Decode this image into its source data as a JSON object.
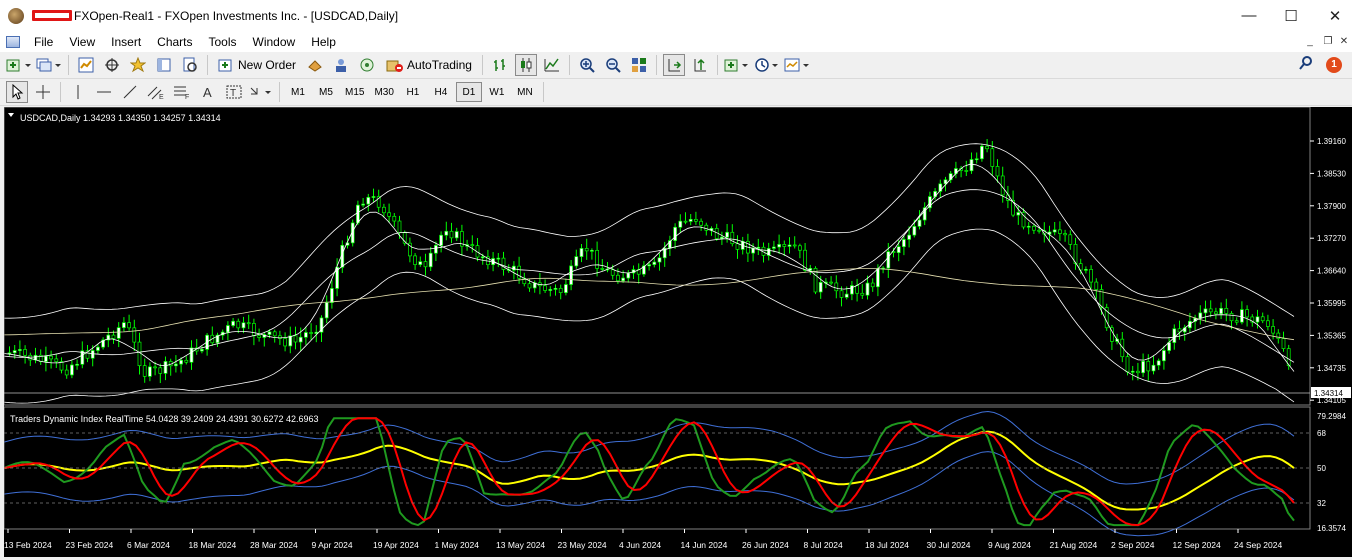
{
  "window": {
    "title": "FXOpen-Real1 - FXOpen Investments Inc. - [USDCAD,Daily]",
    "minimize": "—",
    "maximize": "☐",
    "close": "✕"
  },
  "menu": [
    "File",
    "View",
    "Insert",
    "Charts",
    "Tools",
    "Window",
    "Help"
  ],
  "toolbar": {
    "new_order": "New Order",
    "auto_trading": "AutoTrading"
  },
  "periods": [
    "M1",
    "M5",
    "M15",
    "M30",
    "H1",
    "H4",
    "D1",
    "W1",
    "MN"
  ],
  "active_period": "D1",
  "notifications": "1",
  "chart": {
    "header": "USDCAD,Daily  1.34293 1.34350 1.34257 1.34314",
    "price_axis": [
      "1.39160",
      "1.38530",
      "1.37900",
      "1.37270",
      "1.36640",
      "1.35995",
      "1.35365",
      "1.34735",
      "1.34105"
    ],
    "current_price": "1.34314",
    "indicator_header": "Traders Dynamic Index RealTime 54.0428 39.2409 24.4391 30.6272 42.6963",
    "indicator_axis": [
      "79.2984",
      "68",
      "50",
      "32",
      "16.3574"
    ],
    "dates": [
      "13 Feb 2024",
      "23 Feb 2024",
      "6 Mar 2024",
      "18 Mar 2024",
      "28 Mar 2024",
      "9 Apr 2024",
      "19 Apr 2024",
      "1 May 2024",
      "13 May 2024",
      "23 May 2024",
      "4 Jun 2024",
      "14 Jun 2024",
      "26 Jun 2024",
      "8 Jul 2024",
      "18 Jul 2024",
      "30 Jul 2024",
      "9 Aug 2024",
      "21 Aug 2024",
      "2 Sep 2024",
      "12 Sep 2024",
      "24 Sep 2024"
    ],
    "colors": {
      "background": "#000000",
      "up_candle": "#ffffff",
      "candle_outline": "#00ff00",
      "bands": "#ffffff",
      "ma": "#e6e0b0",
      "tdi_green": "#1f9a1f",
      "tdi_red": "#ff0000",
      "tdi_yellow": "#ffff00",
      "tdi_blue": "#3f6fd6"
    }
  }
}
